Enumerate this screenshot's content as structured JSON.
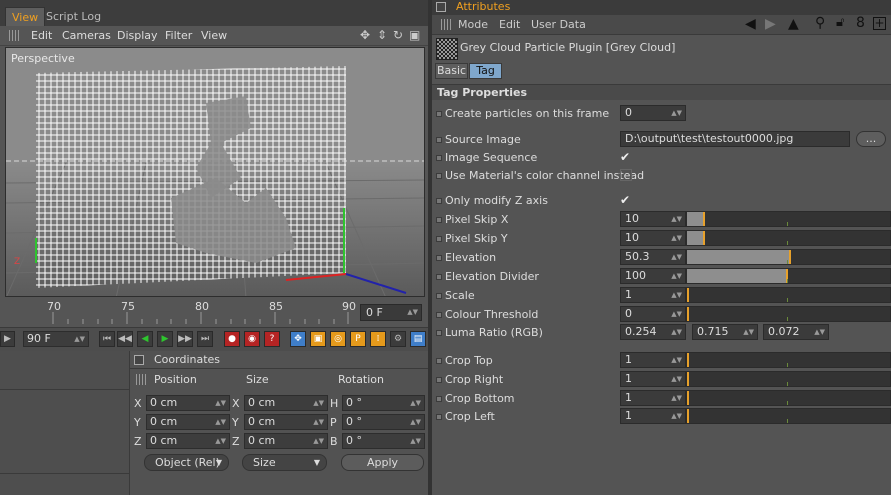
{
  "left_tabs": {
    "view": "View",
    "script_log": "Script Log"
  },
  "viewport_menu": {
    "edit": "Edit",
    "cameras": "Cameras",
    "display": "Display",
    "filter": "Filter",
    "view": "View"
  },
  "viewport": {
    "label": "Perspective"
  },
  "timeline": {
    "ticks": [
      "70",
      "75",
      "80",
      "85",
      "90"
    ],
    "current_frame": "0 F",
    "end_frame": "90 F"
  },
  "coordinates": {
    "title": "Coordinates",
    "col_position": "Position",
    "col_size": "Size",
    "col_rotation": "Rotation",
    "rows": [
      {
        "pos_axis": "X",
        "pos": "0 cm",
        "size_axis": "X",
        "size": "0 cm",
        "rot_axis": "H",
        "rot": "0 °"
      },
      {
        "pos_axis": "Y",
        "pos": "0 cm",
        "size_axis": "Y",
        "size": "0 cm",
        "rot_axis": "P",
        "rot": "0 °"
      },
      {
        "pos_axis": "Z",
        "pos": "0 cm",
        "size_axis": "Z",
        "size": "0 cm",
        "rot_axis": "B",
        "rot": "0 °"
      }
    ],
    "mode": "Object (Rel)",
    "size_mode": "Size",
    "apply": "Apply"
  },
  "attributes": {
    "title": "Attributes",
    "menu": {
      "mode": "Mode",
      "edit": "Edit",
      "user_data": "User Data"
    },
    "object_title": "Grey Cloud Particle Plugin [Grey Cloud]",
    "tab_basic": "Basic",
    "tab_tag": "Tag",
    "section": "Tag Properties",
    "create_label": "Create particles on this frame",
    "create_value": "0",
    "source_label": "Source Image",
    "source_value": "D:\\output\\test\\testout0000.jpg",
    "browse": "...",
    "sequence_label": "Image Sequence",
    "sequence_checked": true,
    "material_label": "Use Material's color channel instead",
    "material_checked": false,
    "onlyz_label": "Only modify Z axis",
    "onlyz_checked": true,
    "sliders": [
      {
        "label": "Pixel Skip X",
        "value": "10",
        "fraction": 0.08
      },
      {
        "label": "Pixel Skip Y",
        "value": "10",
        "fraction": 0.08
      },
      {
        "label": "Elevation",
        "value": "50.3",
        "fraction": 0.5
      },
      {
        "label": "Elevation Divider",
        "value": "100",
        "fraction": 0.49
      },
      {
        "label": "Scale",
        "value": "1",
        "fraction": 0.0
      },
      {
        "label": "Colour Threshold",
        "value": "0",
        "fraction": 0.0
      }
    ],
    "luma_label": "Luma Ratio (RGB)",
    "luma": [
      "0.254",
      "0.715",
      "0.072"
    ],
    "crops": [
      {
        "label": "Crop Top",
        "value": "1",
        "fraction": 0.0
      },
      {
        "label": "Crop Right",
        "value": "1",
        "fraction": 0.0
      },
      {
        "label": "Crop Bottom",
        "value": "1",
        "fraction": 0.0
      },
      {
        "label": "Crop Left",
        "value": "1",
        "fraction": 0.0
      }
    ]
  },
  "colors": {
    "accent": "#f0a020",
    "slider_marker": "#e7a12b"
  }
}
